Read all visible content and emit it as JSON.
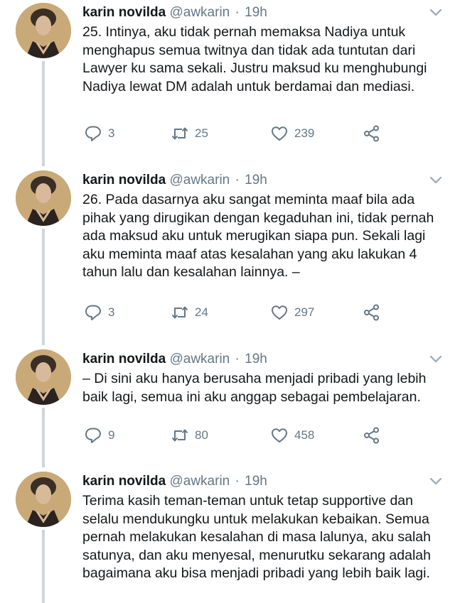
{
  "tweets": [
    {
      "name": "karin novilda",
      "handle": "@awkarin",
      "dot": "·",
      "time": "19h",
      "text": "25. Intinya, aku tidak pernah memaksa Nadiya untuk menghapus semua twitnya dan tidak ada tuntutan dari Lawyer ku sama sekali. Justru maksud ku menghubungi Nadiya lewat DM adalah untuk berdamai dan mediasi.",
      "replies": "3",
      "retweets": "25",
      "likes": "239"
    },
    {
      "name": "karin novilda",
      "handle": "@awkarin",
      "dot": "·",
      "time": "19h",
      "text": "26. Pada dasarnya aku sangat meminta maaf bila ada pihak yang dirugikan dengan kegaduhan ini, tidak pernah ada maksud aku untuk merugikan siapa pun. Sekali lagi aku meminta maaf atas kesalahan yang aku lakukan 4 tahun lalu dan kesalahan lainnya. –",
      "replies": "3",
      "retweets": "24",
      "likes": "297"
    },
    {
      "name": "karin novilda",
      "handle": "@awkarin",
      "dot": "·",
      "time": "19h",
      "text": "– Di sini aku hanya berusaha menjadi pribadi yang lebih baik lagi, semua ini aku anggap sebagai pembelajaran.",
      "replies": "9",
      "retweets": "80",
      "likes": "458"
    },
    {
      "name": "karin novilda",
      "handle": "@awkarin",
      "dot": "·",
      "time": "19h",
      "text": "Terima kasih teman-teman untuk tetap supportive dan selalu mendukungku untuk melakukan kebaikan. Semua pernah melakukan kesalahan di masa lalunya, aku salah satunya, dan aku menyesal, menurutku sekarang adalah bagaimana aku bisa menjadi pribadi yang lebih baik lagi."
    }
  ],
  "icons": {
    "reply": "reply-icon",
    "retweet": "retweet-icon",
    "like": "heart-icon",
    "share": "share-icon",
    "menu": "chevron-down-icon"
  },
  "colors": {
    "text": "#14171a",
    "secondary": "#657786",
    "thread_line": "#ccd6dd",
    "background": "#ffffff"
  }
}
